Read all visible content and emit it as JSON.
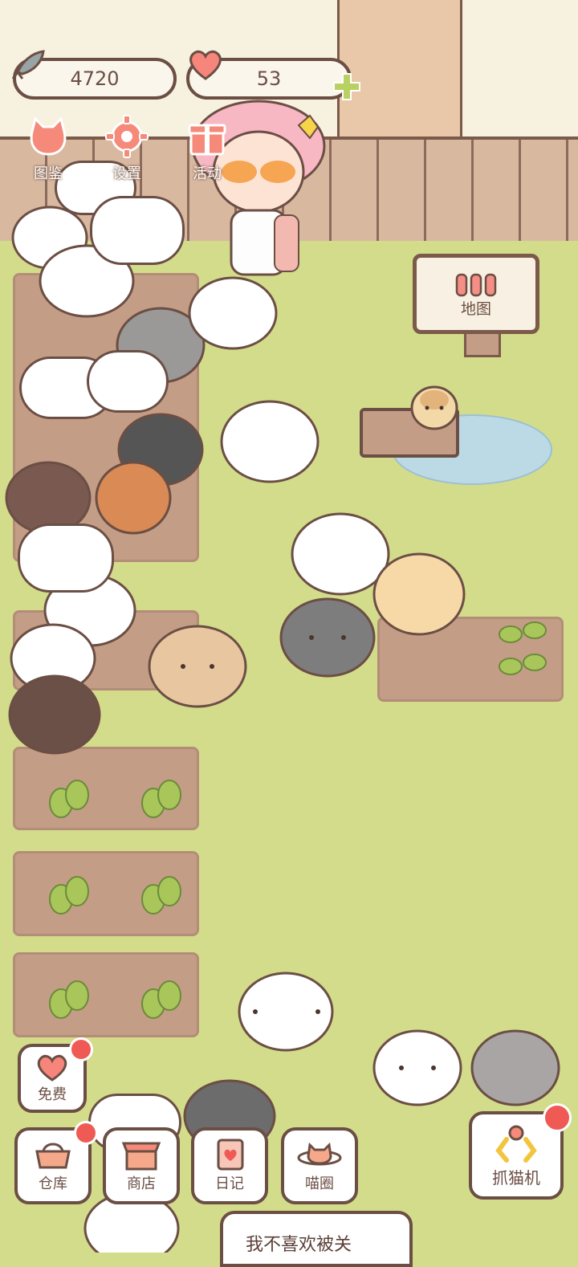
{
  "resources": {
    "fish": {
      "value": "4720",
      "icon": "fish-icon"
    },
    "hearts": {
      "value": "53",
      "icon": "heart-icon",
      "add_icon": "plus-icon"
    }
  },
  "top_menu": [
    {
      "label": "图鉴",
      "icon": "cat-head-icon"
    },
    {
      "label": "设置",
      "icon": "gear-icon"
    },
    {
      "label": "活动",
      "icon": "gift-icon"
    }
  ],
  "map_sign": {
    "label": "地图",
    "icon": "fence-icon"
  },
  "bottom_menu": {
    "free": {
      "label": "免费",
      "icon": "heart-icon",
      "has_badge": true
    },
    "warehouse": {
      "label": "仓库",
      "icon": "basket-icon",
      "has_badge": true
    },
    "shop": {
      "label": "商店",
      "icon": "shop-icon",
      "has_badge": false
    },
    "diary": {
      "label": "日记",
      "icon": "diary-icon",
      "has_badge": false
    },
    "cat_circle": {
      "label": "喵圈",
      "icon": "cat-planet-icon",
      "has_badge": false
    },
    "claw_machine": {
      "label": "抓猫机",
      "icon": "claw-icon",
      "has_badge": true
    }
  },
  "dialog": {
    "text": "我不喜欢被关"
  },
  "colors": {
    "accent_red": "#ef5a54",
    "outline": "#6b4e44",
    "grass": "#d3dc8b",
    "soil": "#c49d86",
    "plus_green": "#b9d160"
  }
}
